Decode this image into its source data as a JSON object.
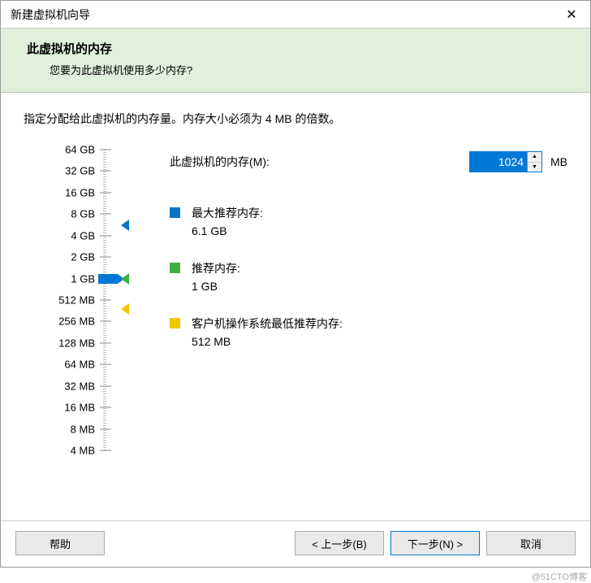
{
  "window": {
    "title": "新建虚拟机向导"
  },
  "header": {
    "title": "此虚拟机的内存",
    "subtitle": "您要为此虚拟机使用多少内存?"
  },
  "instruction": "指定分配给此虚拟机的内存量。内存大小必须为 4 MB 的倍数。",
  "memory": {
    "label": "此虚拟机的内存(M):",
    "value": "1024",
    "unit": "MB"
  },
  "slider": {
    "ticks": [
      "64 GB",
      "32 GB",
      "16 GB",
      "8 GB",
      "4 GB",
      "2 GB",
      "1 GB",
      "512 MB",
      "256 MB",
      "128 MB",
      "64 MB",
      "32 MB",
      "16 MB",
      "8 MB",
      "4 MB"
    ],
    "current_index": 6,
    "markers": {
      "max_index_approx": 3.5,
      "rec_index": 6,
      "min_index_approx": 7.4
    }
  },
  "legend": {
    "max": {
      "title": "最大推荐内存:",
      "value": "6.1 GB"
    },
    "rec": {
      "title": "推荐内存:",
      "value": "1 GB"
    },
    "min": {
      "title": "客户机操作系统最低推荐内存:",
      "value": "512 MB"
    }
  },
  "buttons": {
    "help": "帮助",
    "back": "< 上一步(B)",
    "next": "下一步(N) >",
    "cancel": "取消"
  },
  "watermark": "@51CTO博客"
}
